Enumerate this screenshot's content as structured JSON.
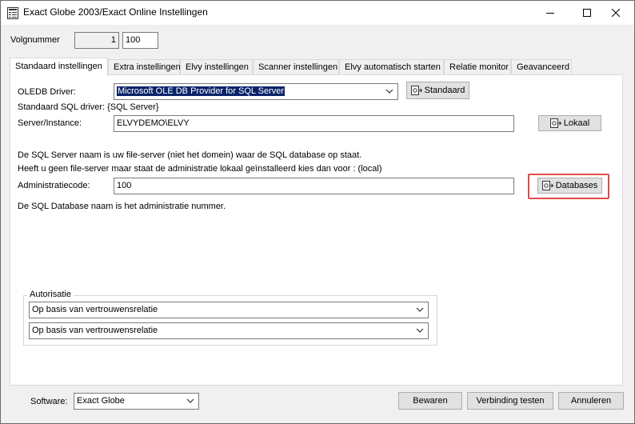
{
  "window": {
    "title": "Exact Globe 2003/Exact Online Instellingen",
    "icon": "app-window-icon",
    "controls": [
      "minimize-icon",
      "maximize-icon",
      "close-icon"
    ]
  },
  "volgnummer": {
    "label": "Volgnummer",
    "readonly_value": "1",
    "value": "100"
  },
  "tabs": [
    {
      "label": "Standaard instellingen",
      "active": true
    },
    {
      "label": "Extra instellingen",
      "active": false
    },
    {
      "label": "Elvy instellingen",
      "active": false
    },
    {
      "label": "Scanner instellingen",
      "active": false
    },
    {
      "label": "Elvy automatisch starten",
      "active": false
    },
    {
      "label": "Relatie monitor",
      "active": false
    },
    {
      "label": "Geavanceerd",
      "active": false
    }
  ],
  "standaard": {
    "oledb_label": "OLEDB Driver:",
    "oledb_value": "Microsoft OLE DB Provider for SQL Server",
    "standaard_button": "Standaard",
    "sql_driver_text": "Standaard SQL driver: {SQL Server}",
    "server_label": "Server/Instance:",
    "server_value": "ELVYDEMO\\ELVY",
    "lokaal_button": "Lokaal",
    "info_line1": "De SQL Server naam is uw file-server (niet het domein) waar de SQL database op staat.",
    "info_line2": "Heeft u geen file-server maar staat de administratie lokaal geïnstalleerd kies dan voor : (local)",
    "admin_label": "Administratiecode:",
    "admin_value": "100",
    "databases_button": "Databases",
    "db_info": "De SQL Database naam is het administratie nummer."
  },
  "autorisatie": {
    "legend": "Autorisatie",
    "select1": "Op basis van vertrouwensrelatie",
    "select2": "Op basis van vertrouwensrelatie"
  },
  "footer": {
    "software_label": "Software:",
    "software_value": "Exact Globe",
    "bewaren": "Bewaren",
    "verbinding": "Verbinding testen",
    "annuleren": "Annuleren"
  },
  "colors": {
    "highlight_border": "#e04b4b",
    "selection_bg": "#0a246a"
  }
}
